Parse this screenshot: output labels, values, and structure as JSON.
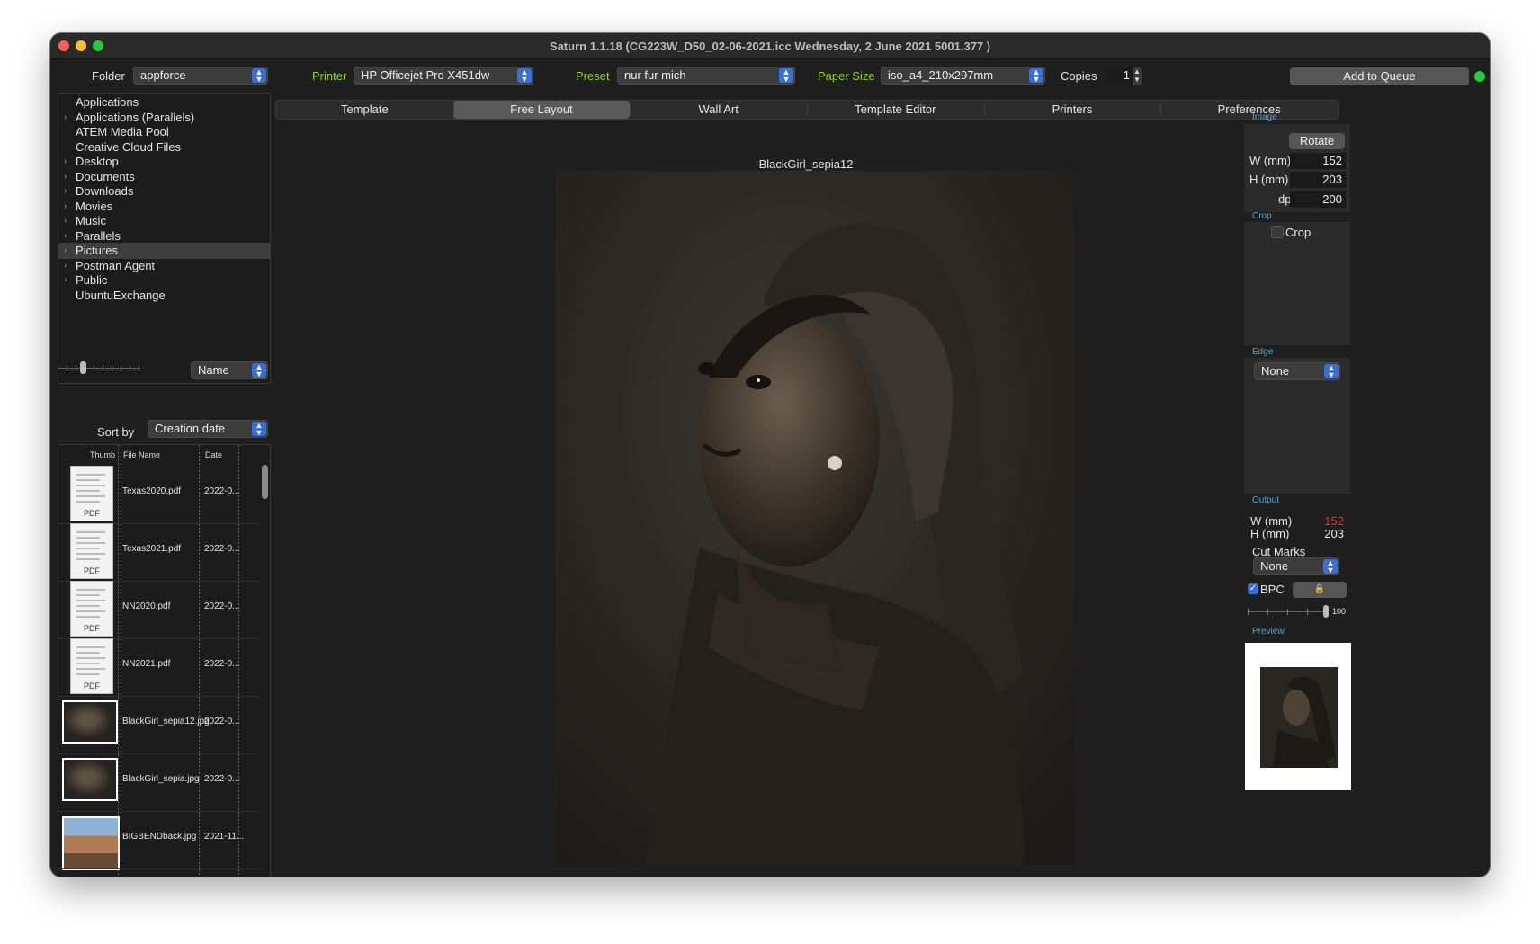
{
  "window": {
    "title": "Saturn 1.1.18 (CG223W_D50_02-06-2021.icc Wednesday, 2 June 2021  5001.377 )"
  },
  "toolbar": {
    "folder_label": "Folder",
    "folder_value": "appforce",
    "printer_label": "Printer",
    "printer_value": "HP Officejet Pro X451dw",
    "preset_label": "Preset",
    "preset_value": "nur fur mich",
    "paper_label": "Paper Size",
    "paper_value": "iso_a4_210x297mm",
    "copies_label": "Copies",
    "copies_value": "1",
    "queue_button": "Add to Queue",
    "status_color": "#28c840"
  },
  "sidebar": {
    "folders": [
      {
        "label": "Applications",
        "arrow": false
      },
      {
        "label": "Applications (Parallels)",
        "arrow": true
      },
      {
        "label": "ATEM Media Pool",
        "arrow": false
      },
      {
        "label": "Creative Cloud Files",
        "arrow": false
      },
      {
        "label": "Desktop",
        "arrow": true
      },
      {
        "label": "Documents",
        "arrow": true
      },
      {
        "label": "Downloads",
        "arrow": true
      },
      {
        "label": "Movies",
        "arrow": true
      },
      {
        "label": "Music",
        "arrow": true
      },
      {
        "label": "Parallels",
        "arrow": true
      },
      {
        "label": "Pictures",
        "arrow": true
      },
      {
        "label": "Postman Agent",
        "arrow": true
      },
      {
        "label": "Public",
        "arrow": true
      },
      {
        "label": "UbuntuExchange",
        "arrow": false
      }
    ],
    "selected_folder": "Pictures",
    "view_value": "Name",
    "sort_label": "Sort by",
    "sort_value": "Creation date"
  },
  "file_table": {
    "columns": [
      "Thumb",
      "File Name",
      "Date"
    ],
    "rows": [
      {
        "thumb": "pdf",
        "name": "Texas2020.pdf",
        "date": "2022-0..."
      },
      {
        "thumb": "pdf",
        "name": "Texas2021.pdf",
        "date": "2022-0..."
      },
      {
        "thumb": "pdf",
        "name": "NN2020.pdf",
        "date": "2022-0..."
      },
      {
        "thumb": "pdf",
        "name": "NN2021.pdf",
        "date": "2022-0..."
      },
      {
        "thumb": "photo",
        "name": "BlackGirl_sepia12.jpg",
        "date": "2022-0..."
      },
      {
        "thumb": "photo",
        "name": "BlackGirl_sepia.jpg",
        "date": "2022-0..."
      },
      {
        "thumb": "landscape",
        "name": "BIGBENDback.jpg",
        "date": "2021-11..."
      }
    ],
    "pdf_badge": "PDF"
  },
  "tabs": [
    "Template",
    "Free Layout",
    "Wall Art",
    "Template Editor",
    "Printers",
    "Preferences"
  ],
  "active_tab": "Free Layout",
  "canvas": {
    "image_title": "BlackGirl_sepia12"
  },
  "image_panel": {
    "section": "Image",
    "rotate_button": "Rotate",
    "w_label": "W (mm)",
    "w_value": "152",
    "h_label": "H (mm)",
    "h_value": "203",
    "dpi_label": "dpi",
    "dpi_value": "200"
  },
  "crop_panel": {
    "section": "Crop",
    "checkbox_label": "Crop",
    "checked": false
  },
  "edge_panel": {
    "section": "Edge",
    "value": "None"
  },
  "output_panel": {
    "section": "Output",
    "w_label": "W (mm)",
    "w_value": "152",
    "w_value_color": "#e5322d",
    "h_label": "H (mm)",
    "h_value": "203",
    "cutmarks_label": "Cut Marks",
    "cutmarks_value": "None",
    "bpc_label": "BPC",
    "bpc_checked": true,
    "slider_value": "100"
  },
  "preview_panel": {
    "section": "Preview"
  }
}
